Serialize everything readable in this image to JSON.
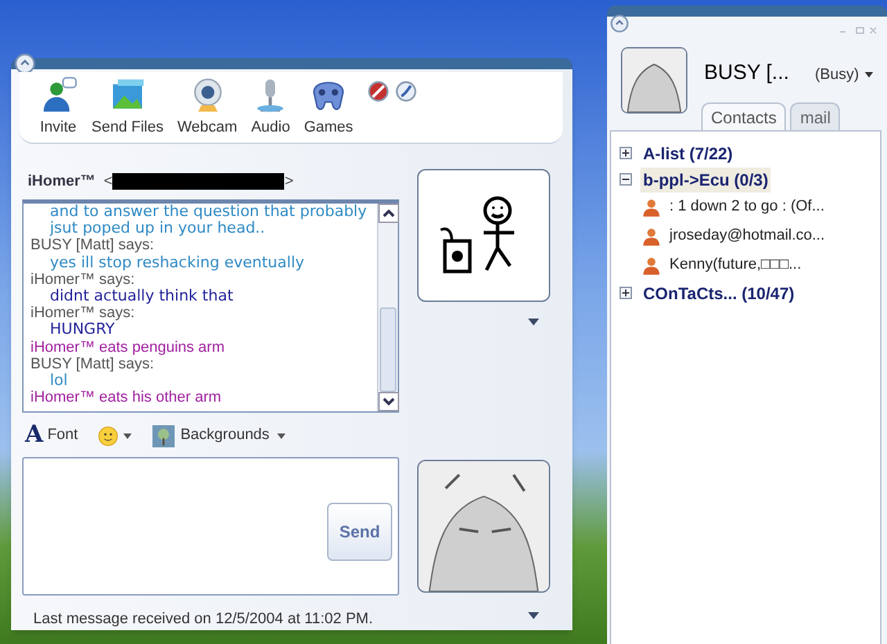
{
  "chat_window": {
    "toolbar": [
      {
        "label": "Invite"
      },
      {
        "label": "Send Files"
      },
      {
        "label": "Webcam"
      },
      {
        "label": "Audio"
      },
      {
        "label": "Games"
      }
    ],
    "recipient": {
      "name": "iHomer™",
      "open_bracket": "<",
      "close_bracket": ">"
    },
    "history": [
      {
        "kind": "message",
        "text": "and to answer the question that probably",
        "color": "#2f8ac4"
      },
      {
        "kind": "message",
        "text": "jsut poped up in your head..",
        "color": "#2f8ac4"
      },
      {
        "kind": "sender",
        "text": "BUSY [Matt] says:"
      },
      {
        "kind": "message",
        "text": "yes ill stop reshacking eventually",
        "color": "#2f8ac4"
      },
      {
        "kind": "sender",
        "text": "iHomer™  says:"
      },
      {
        "kind": "message",
        "text": "didnt actually think that",
        "color": "#23239a"
      },
      {
        "kind": "sender",
        "text": "iHomer™  says:"
      },
      {
        "kind": "message",
        "text": "HUNGRY",
        "color": "#23239a"
      },
      {
        "kind": "action",
        "text": "iHomer™  eats penguins arm"
      },
      {
        "kind": "sender",
        "text": "BUSY [Matt] says:"
      },
      {
        "kind": "message",
        "text": "lol",
        "color": "#2f8ac4"
      },
      {
        "kind": "action",
        "text": "iHomer™  eats his other arm"
      }
    ],
    "format_bar": {
      "font_label": "Font",
      "font_glyph": "A",
      "backgrounds_label": "Backgrounds"
    },
    "send_button": "Send",
    "status": "Last message received on 12/5/2004 at 11:02 PM."
  },
  "contacts_window": {
    "display_name": "BUSY [...",
    "status": "(Busy)",
    "tabs": [
      {
        "label": "Contacts",
        "selected": true
      },
      {
        "label": "mail",
        "selected": false
      }
    ],
    "groups": [
      {
        "label": "A-list (7/22)",
        "expanded": false,
        "selected": false
      },
      {
        "label": "b-ppl->Ecu (0/3)",
        "expanded": true,
        "selected": true,
        "children": [
          {
            "label": ": 1 down 2 to go : (Of..."
          },
          {
            "label": "jroseday@hotmail.co..."
          },
          {
            "label": "Kenny(future,□□□..."
          }
        ]
      },
      {
        "label": "COnTaCts... (10/47)",
        "expanded": false,
        "selected": false
      }
    ]
  }
}
